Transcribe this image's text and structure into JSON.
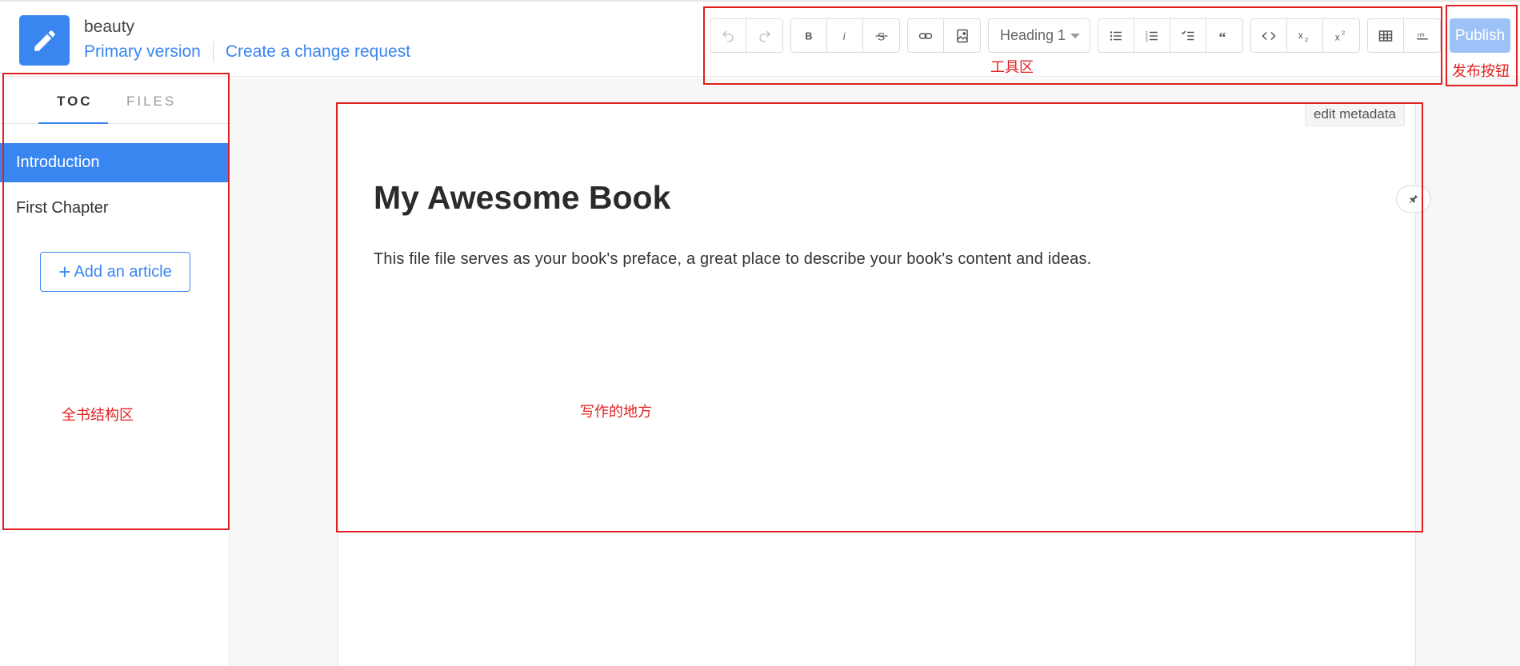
{
  "header": {
    "book_name": "beauty",
    "primary_version": "Primary version",
    "change_request": "Create a change request"
  },
  "toolbar": {
    "heading_select": "Heading 1",
    "publish_label": "Publish",
    "buttons": [
      "undo-icon",
      "redo-icon",
      "bold-icon",
      "italic-icon",
      "strikethrough-icon",
      "link-icon",
      "image-icon",
      "bullet-list-icon",
      "ordered-list-icon",
      "task-list-icon",
      "blockquote-icon",
      "code-icon",
      "subscript-icon",
      "superscript-icon",
      "table-icon",
      "horizontal-rule-icon"
    ]
  },
  "sidebar": {
    "tabs": [
      {
        "label": "TOC",
        "active": true
      },
      {
        "label": "FILES",
        "active": false
      }
    ],
    "items": [
      {
        "label": "Introduction",
        "active": true
      },
      {
        "label": "First Chapter",
        "active": false
      }
    ],
    "add_article": "Add an article"
  },
  "editor": {
    "edit_metadata": "edit metadata",
    "title": "My Awesome Book",
    "body": "This file file serves as your book's preface, a great place to describe your book's content and ideas."
  },
  "annotations": {
    "toolbar_area": "工具区",
    "publish_button": "发布按钮",
    "book_structure_area": "全书结构区",
    "writing_area": "写作的地方"
  },
  "colors": {
    "accent": "#3a86f0",
    "publish_bg": "#9cc2f7",
    "annotation": "#e0201e"
  }
}
